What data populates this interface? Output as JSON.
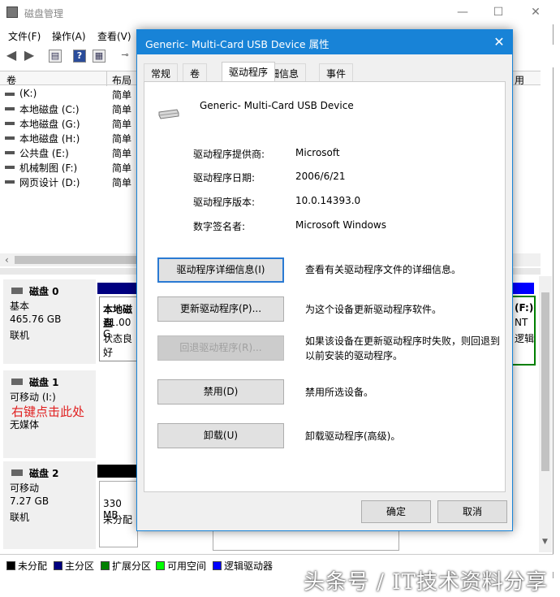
{
  "window": {
    "title": "磁盘管理",
    "menu": [
      "文件(F)",
      "操作(A)",
      "查看(V)"
    ],
    "columns": [
      "卷",
      "布局"
    ],
    "right_col_header": "用",
    "volumes": [
      {
        "name": "(K:)",
        "layout": "简单"
      },
      {
        "name": "本地磁盘 (C:)",
        "layout": "简单"
      },
      {
        "name": "本地磁盘 (G:)",
        "layout": "简单"
      },
      {
        "name": "本地磁盘 (H:)",
        "layout": "简单"
      },
      {
        "name": "公共盘 (E:)",
        "layout": "简单"
      },
      {
        "name": "机械制图 (F:)",
        "layout": "简单"
      },
      {
        "name": "网页设计 (D:)",
        "layout": "简单"
      }
    ],
    "disks": [
      {
        "title": "磁盘 0",
        "type": "基本",
        "size": "465.76 GB",
        "status": "联机"
      },
      {
        "title": "磁盘 1",
        "type": "可移动 (I:)",
        "size": "",
        "status": "无媒体"
      },
      {
        "title": "磁盘 2",
        "type": "可移动",
        "size": "7.27 GB",
        "status": "联机"
      }
    ],
    "disk0_partition": {
      "name": "本地磁盘",
      "size": "71.00 G",
      "status": "状态良好"
    },
    "disk0_right_partition": {
      "label": "(F:)",
      "fs": "NT",
      "status": "逻辑"
    },
    "disk2_partition": {
      "size": "330 MB",
      "status": "未分配"
    },
    "legend": [
      {
        "label": "未分配",
        "color": "#000000"
      },
      {
        "label": "主分区",
        "color": "#000080"
      },
      {
        "label": "扩展分区",
        "color": "#008000"
      },
      {
        "label": "可用空间",
        "color": "#00ff00"
      },
      {
        "label": "逻辑驱动器",
        "color": "#0000ff"
      }
    ],
    "annotation": "右键点击此处",
    "watermark": "头条号 / IT技术资料分享"
  },
  "dialog": {
    "title": "Generic- Multi-Card USB Device 属性",
    "tabs": [
      "常规",
      "卷",
      "驱动程序",
      "详细信息",
      "事件"
    ],
    "active_tab": "驱动程序",
    "device_name": "Generic- Multi-Card USB Device",
    "info": [
      {
        "label": "驱动程序提供商:",
        "value": "Microsoft"
      },
      {
        "label": "驱动程序日期:",
        "value": "2006/6/21"
      },
      {
        "label": "驱动程序版本:",
        "value": "10.0.14393.0"
      },
      {
        "label": "数字签名者:",
        "value": "Microsoft Windows"
      }
    ],
    "actions": [
      {
        "button": "驱动程序详细信息(I)",
        "desc": "查看有关驱动程序文件的详细信息。"
      },
      {
        "button": "更新驱动程序(P)...",
        "desc": "为这个设备更新驱动程序软件。"
      },
      {
        "button": "回退驱动程序(R)...",
        "desc": "如果该设备在更新驱动程序时失败，则回退到以前安装的驱动程序。"
      },
      {
        "button": "禁用(D)",
        "desc": "禁用所选设备。"
      },
      {
        "button": "卸载(U)",
        "desc": "卸载驱动程序(高级)。"
      }
    ],
    "ok": "确定",
    "cancel": "取消"
  }
}
